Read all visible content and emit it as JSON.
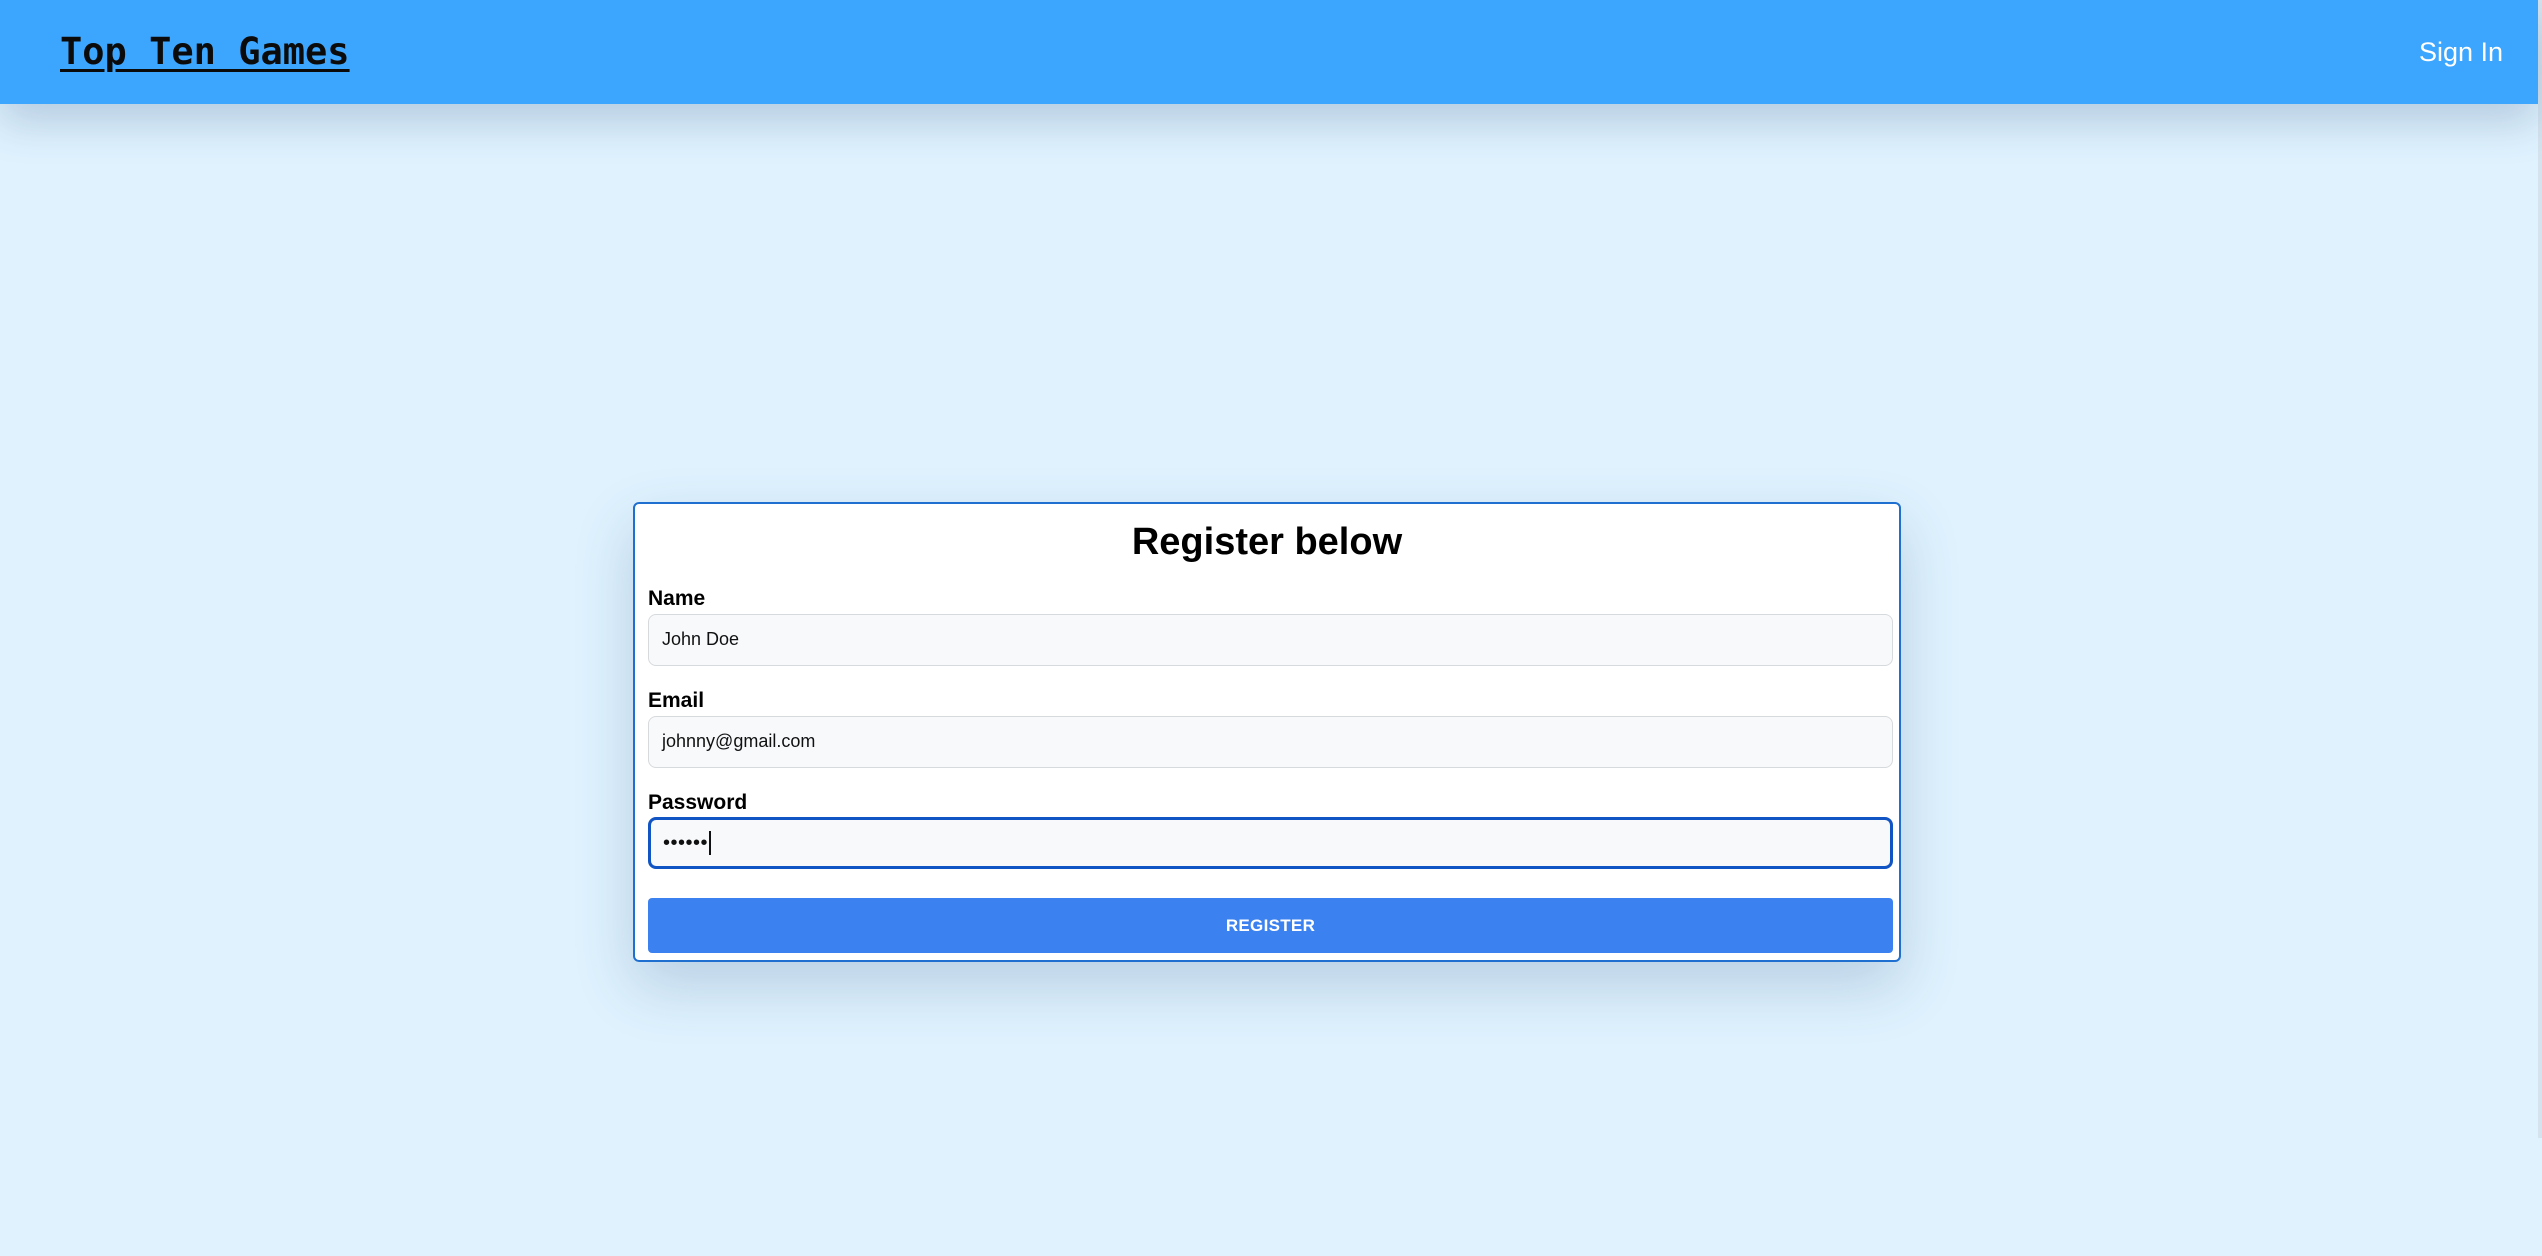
{
  "header": {
    "brand": "Top Ten Games",
    "signin_label": "Sign In"
  },
  "form": {
    "title": "Register below",
    "fields": {
      "name": {
        "label": "Name",
        "value": "John Doe"
      },
      "email": {
        "label": "Email",
        "value": "johnny@gmail.com"
      },
      "password": {
        "label": "Password",
        "value": "••••••"
      }
    },
    "submit_label": "REGISTER"
  },
  "colors": {
    "page_background": "#dff2fe",
    "header_background": "#3ca6ff",
    "card_border": "#1f6fd0",
    "button_background": "#3b82f0",
    "focus_border": "#1155c4"
  }
}
